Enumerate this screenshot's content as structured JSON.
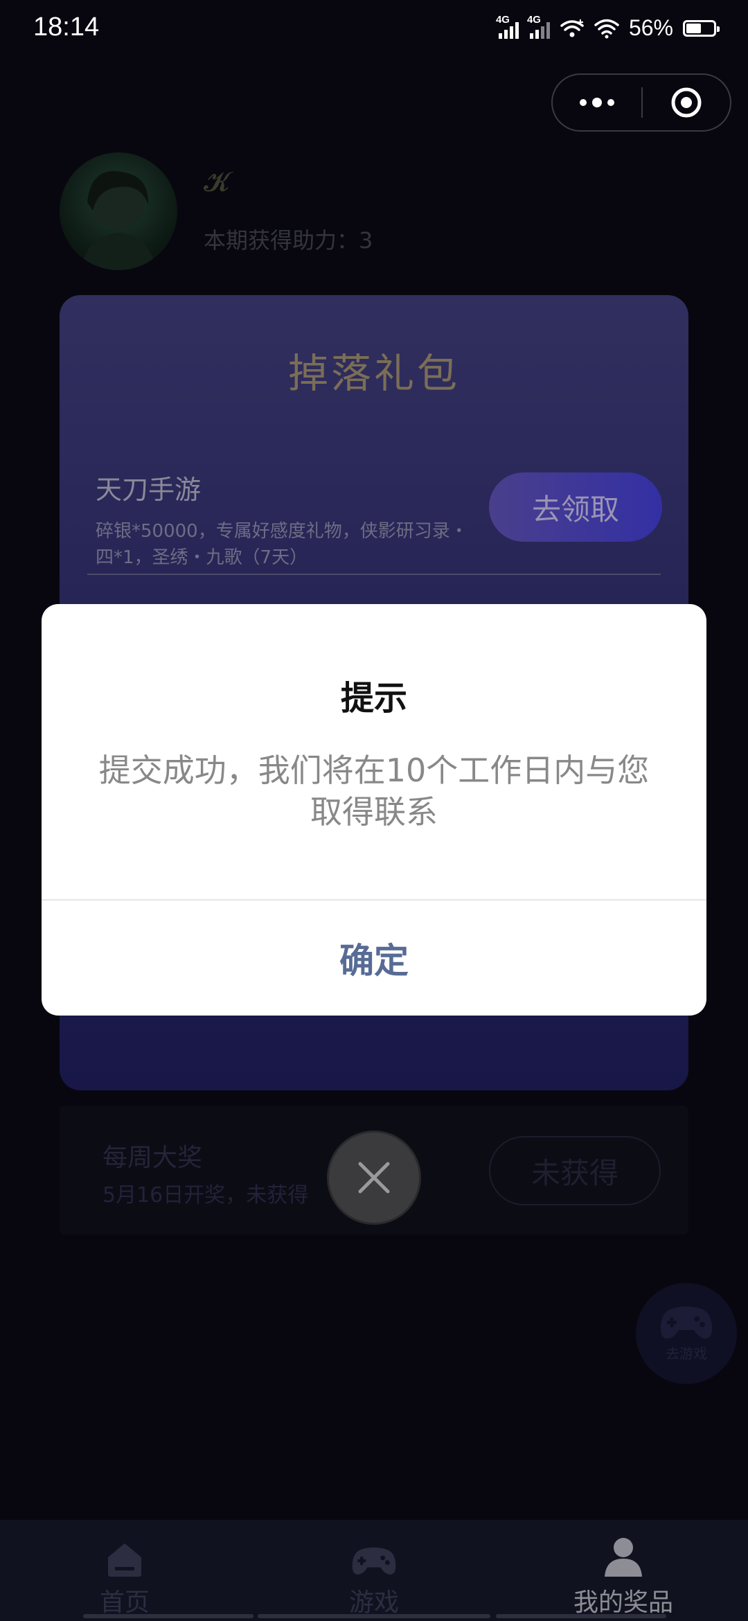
{
  "status_bar": {
    "time": "18:14",
    "network_1": "4G",
    "network_2": "4G",
    "battery_percent": "56%",
    "battery_level": 0.56
  },
  "capsule": {
    "more_icon": "more-dots-icon",
    "close_icon": "target-circle-icon"
  },
  "profile": {
    "nickname": "𝓚",
    "assist_text": "本期获得助力：3"
  },
  "gift_card": {
    "title": "掉落礼包",
    "game_name": "天刀手游",
    "description": "碎银*50000，专属好感度礼物，侠影研习录・四*1，圣绣・九歌（7天）",
    "claim_label": "去领取"
  },
  "weekly_prize": {
    "title": "每周大奖",
    "subtitle": "5月16日开奖，未获得",
    "button_label": "未获得"
  },
  "floating_button": {
    "label": "去游戏",
    "icon": "gamepad-icon"
  },
  "tabbar": {
    "tabs": [
      {
        "label": "首页",
        "icon": "home-icon",
        "active": false
      },
      {
        "label": "游戏",
        "icon": "gamepad-icon",
        "active": false
      },
      {
        "label": "我的奖品",
        "icon": "user-icon",
        "active": true
      }
    ]
  },
  "dialog": {
    "title": "提示",
    "message": "提交成功，我们将在10个工作日内与您取得联系",
    "confirm_label": "确定"
  },
  "colors": {
    "background": "#08070f",
    "dialog_button": "#576b95",
    "card_gradient_top": "#312f5e",
    "card_gradient_bottom": "#181747"
  }
}
